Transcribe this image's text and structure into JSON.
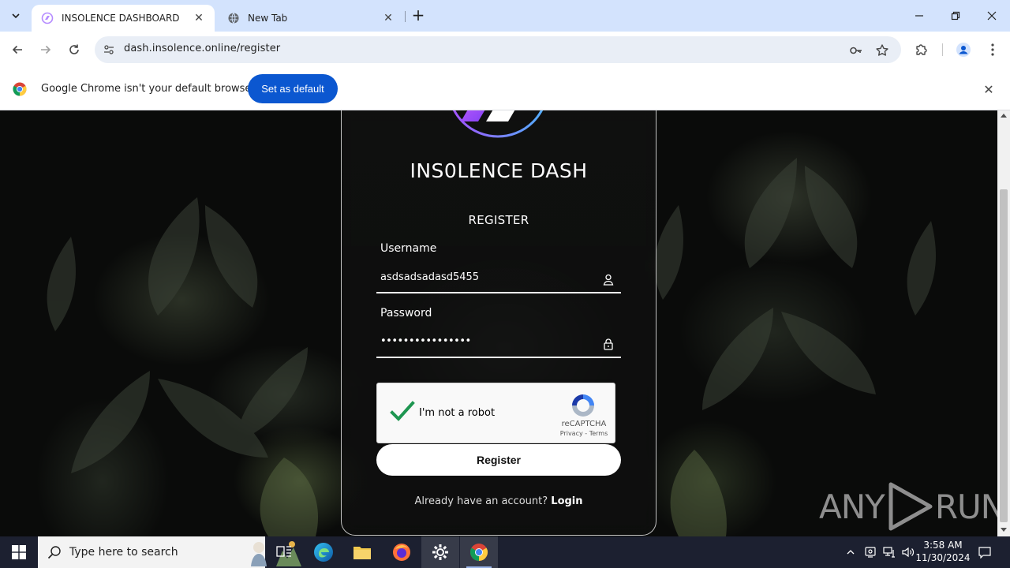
{
  "browser": {
    "tabs": [
      {
        "title": "INSOLENCE DASHBOARD",
        "active": true
      },
      {
        "title": "New Tab",
        "active": false
      }
    ],
    "url": "dash.insolence.online/register",
    "infobar": {
      "message": "Google Chrome isn't your default browser",
      "button": "Set as default"
    }
  },
  "page": {
    "brand": "INS0LENCE DASH",
    "heading": "REGISTER",
    "username": {
      "label": "Username",
      "value": "asdsadsadasd5455"
    },
    "password": {
      "label": "Password",
      "value": "••••••••••••••••"
    },
    "captcha": {
      "text": "I'm not a robot",
      "brand": "reCAPTCHA",
      "links": "Privacy - Terms"
    },
    "register_button": "Register",
    "login_prompt": "Already have an account?",
    "login_link": "Login"
  },
  "watermark": {
    "left": "ANY",
    "right": "RUN"
  },
  "taskbar": {
    "search_placeholder": "Type here to search",
    "time": "3:58 AM",
    "date": "11/30/2024"
  },
  "colors": {
    "accent_button": "#0b57d0",
    "tab_strip": "#d3e3fd",
    "taskbar": "#1c2030",
    "logo_gradient_start": "#a64dff",
    "logo_gradient_end": "#4fb3ff"
  }
}
